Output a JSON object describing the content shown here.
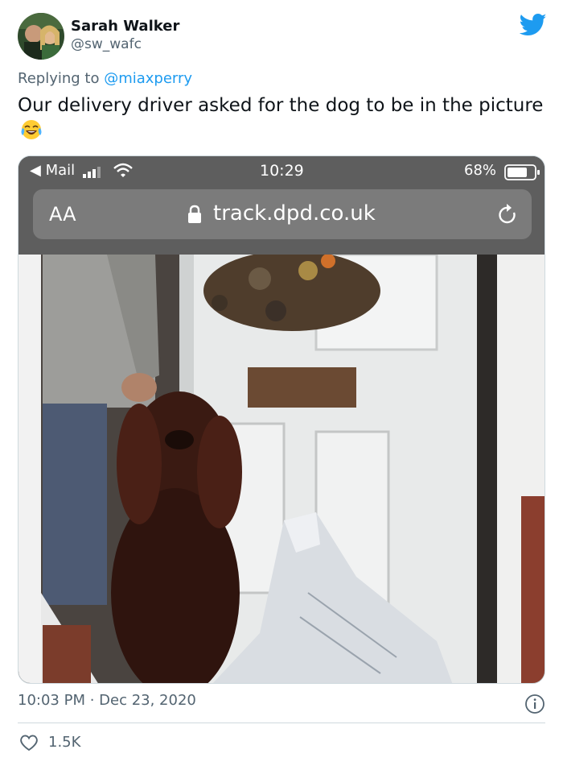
{
  "author": {
    "name": "Sarah Walker",
    "handle": "@sw_wafc",
    "avatar_icon": "avatar-couple-photo"
  },
  "platform_icon": "twitter-bird-icon",
  "reply": {
    "prefix": "Replying to ",
    "to": "@miaxperry"
  },
  "tweet": {
    "text": "Our delivery driver asked for the dog to be in the picture",
    "emoji": "face-with-tears-of-joy"
  },
  "screenshot": {
    "status_bar": {
      "back_app": "◀ Mail",
      "time": "10:29",
      "battery": "68%"
    },
    "browser": {
      "text_size_button": "AA",
      "url": "track.dpd.co.uk"
    },
    "photo_subject": "dog-at-front-door-with-parcel"
  },
  "footer": {
    "timestamp": "10:03 PM · Dec 23, 2020",
    "likes": "1.5K"
  },
  "colors": {
    "text": "#0f1419",
    "secondary": "#536471",
    "accent": "#1d9bf0",
    "border": "#cfd9de"
  }
}
